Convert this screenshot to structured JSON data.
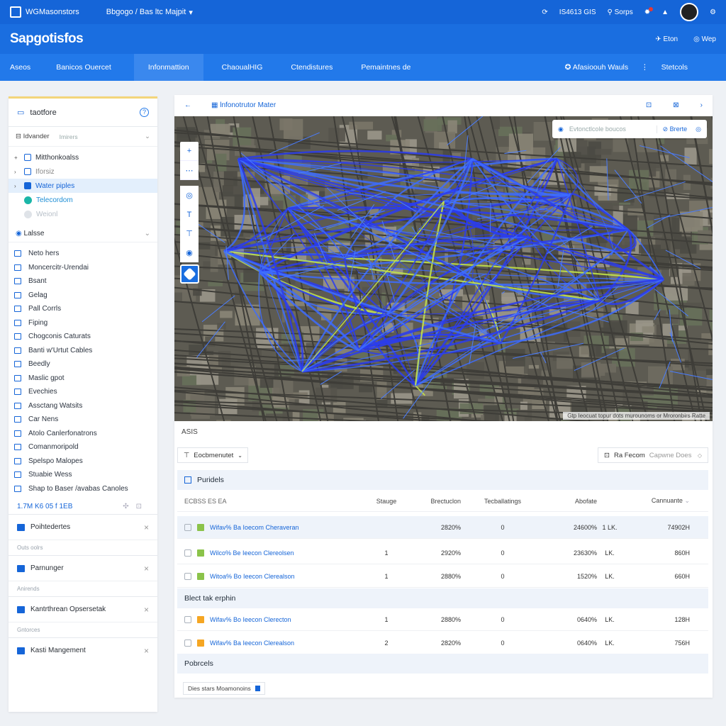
{
  "topbar": {
    "workspace": "WGMasonstors",
    "project": "Bbgogo / Bas ltc Majpit",
    "status": "IS4613 GIS",
    "user": "Sorps",
    "bell_icon": "bell-icon"
  },
  "brandbar": {
    "brand": "Sapgotisfos",
    "link1": "Eton",
    "link2": "Wep"
  },
  "navbar": {
    "tabs": [
      "Aseos",
      "Banicos Ouercet",
      "Infonmattion",
      "ChaoualHIG",
      "Ctendistures",
      "Pemaintnes de"
    ],
    "active_index": 2,
    "right1": "Afasioouh Wauls",
    "right2": "Stetcols"
  },
  "sidebar": {
    "title": "taotfore",
    "sub_label": "Idvander",
    "sub_muted": "Imirers",
    "tree": [
      {
        "label": "Mitthonkoalss",
        "kind": "folder"
      },
      {
        "label": "Iforsiz",
        "kind": "folder-dim"
      },
      {
        "label": "Water piples",
        "kind": "selected"
      },
      {
        "label": "Telecordom",
        "kind": "teal"
      },
      {
        "label": "Weionl",
        "kind": "dim"
      }
    ],
    "layers_title": "Lalsse",
    "layers": [
      "Neto hers",
      "Moncercitr-Urendai",
      "Bsant",
      "Gelag",
      "Pall Corrls",
      "Fiping",
      "Chogconis Caturats",
      "Banti w'Urtut Cables",
      "Beedly",
      "Maslic gpot",
      "Evechies",
      "Assctang Watsits",
      "Car Nens",
      "Atolo Canlerfonatrons",
      "Comanmoripold",
      "Spelspo Malopes",
      "Stuabie Wess",
      "Shap to Baser /avabas Canoles"
    ],
    "count": "1.7M K6 05 f 1EB",
    "panels": [
      {
        "label": "Poihtedertes",
        "section": ""
      },
      {
        "label": "Parnunger",
        "section": "Outs oolrs"
      },
      {
        "label": "Kantrthrean Opsersetak",
        "section": "Anirends"
      },
      {
        "label": "Kasti Mangement",
        "section": "Gntorces"
      }
    ]
  },
  "main": {
    "map_title": "lnfonotrutor Mater",
    "search_placeholder": "Evtonctlcole boucos",
    "search_button": "Brerte",
    "attribution": "Gtp Ieocuat topur dots murounoms or Mroronbirs Ratte",
    "section_label": "ASIS",
    "filter_dropdown": "Eocbmenutet",
    "filter_search_label": "Ra Fecom",
    "filter_search_ph": "Capwne Does",
    "group1": "Puridels",
    "columns": [
      "ECBSS ES EA",
      "Stauge",
      "Brectuclon",
      "Tecballatings",
      "Abofate",
      "",
      "Cannuante"
    ],
    "rows_a": [
      {
        "name": "Wifav% Ba Ioecom Cheraveran",
        "stage": "",
        "b": "2820%",
        "t": "0",
        "a": "24600%",
        "u": "1 LK.",
        "c": "74902H"
      },
      {
        "name": "Wilco% Be Ieecon Clereolsen",
        "stage": "1",
        "b": "2920%",
        "t": "0",
        "a": "23630%",
        "u": "LK.",
        "c": "860H"
      },
      {
        "name": "Witoa% Bo Ieecon Clerealson",
        "stage": "1",
        "b": "2880%",
        "t": "0",
        "a": "1520%",
        "u": "LK.",
        "c": "660H"
      }
    ],
    "group2": "Blect tak erphin",
    "rows_b": [
      {
        "name": "Wifav% Bo Ieecon Clerecton",
        "stage": "1",
        "b": "2880%",
        "t": "0",
        "a": "0640%",
        "u": "LK.",
        "c": "128H"
      },
      {
        "name": "Wifav% Ba Ieecon Clerealson",
        "stage": "2",
        "b": "2820%",
        "t": "0",
        "a": "0640%",
        "u": "LK.",
        "c": "756H"
      }
    ],
    "group3": "Pobrcels",
    "footer": "Dies stars Moamonoins"
  }
}
